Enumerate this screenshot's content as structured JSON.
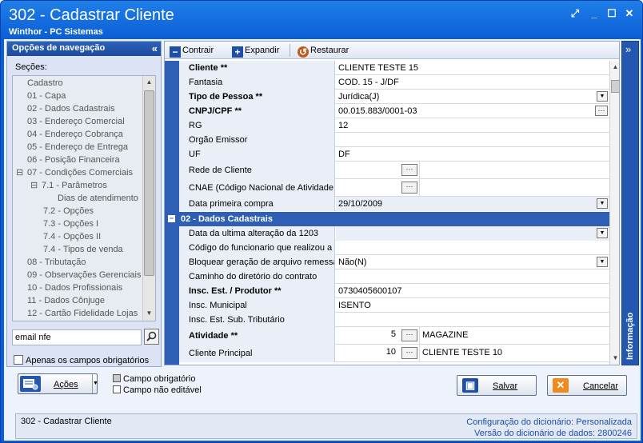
{
  "window": {
    "title": "302 - Cadastrar Cliente",
    "subtitle": "Winthor - PC Sistemas",
    "buttons": [
      "⤢",
      "_",
      "☐",
      "✕"
    ]
  },
  "nav": {
    "header": "Opções de navegação",
    "sections_label": "Seções:",
    "items": [
      "Cadastro",
      "01 - Capa",
      "02 - Dados Cadastrais",
      "03 - Endereço Comercial",
      "04 - Endereço Cobrança",
      "05 - Endereço de Entrega",
      "06 - Posição Financeira",
      "07 - Condições Comerciais",
      "7.1 - Parâmetros",
      "Dias de atendimento",
      "7.2 - Opções",
      "7.3 - Opções I",
      "7.4 - Opções II",
      "7.4 - Tipos de venda",
      "08 - Tributação",
      "09 - Observações Gerenciais",
      "10 - Dados Profissionais",
      "11 - Dados Cônjuge",
      "12 - Cartão Fidelidade Lojas"
    ],
    "search_value": "email nfe",
    "only_required_label": "Apenas os campos obrigatórios"
  },
  "toolbar": {
    "collapse": "Contrair",
    "expand": "Expandir",
    "restore": "Restaurar"
  },
  "grid": {
    "rows1": [
      {
        "label": "Cliente **",
        "bold": true,
        "value": "CLIENTE TESTE 15"
      },
      {
        "label": "Fantasia",
        "value": "COD. 15 - J/DF"
      },
      {
        "label": "Tipo de Pessoa **",
        "bold": true,
        "value": "Jurídica(J)"
      },
      {
        "label": "CNPJ/CPF **",
        "bold": true,
        "value": "00.015.883/0001-03"
      },
      {
        "label": "RG",
        "value": "12"
      },
      {
        "label": "Orgão Emissor",
        "value": ""
      },
      {
        "label": "UF",
        "value": "DF"
      },
      {
        "label": "Rede de Cliente",
        "value": ""
      },
      {
        "label": "CNAE (Código Nacional de Atividade E",
        "value": ""
      },
      {
        "label": "Data primeira compra",
        "value": "29/10/2009"
      }
    ],
    "section2": "02 - Dados Cadastrais",
    "rows2": [
      {
        "label": "Data da ultima alteração da 1203",
        "value": ""
      },
      {
        "label": "Código do funcionario que realizou a u",
        "value": ""
      },
      {
        "label": "Bloquear geração de arquivo remessa",
        "value": "Não(N)"
      },
      {
        "label": "Caminho do diretório do contrato",
        "value": ""
      },
      {
        "label": "Insc. Est. / Produtor **",
        "bold": true,
        "value": "0730405600107"
      },
      {
        "label": "Insc. Municipal",
        "value": "ISENTO"
      },
      {
        "label": "Insc. Est. Sub. Tributário",
        "value": ""
      },
      {
        "label": "Atividade **",
        "bold": true,
        "code": "5",
        "value": "MAGAZINE"
      },
      {
        "label": "Cliente Principal",
        "code": "10",
        "value": "CLIENTE TESTE 10"
      }
    ]
  },
  "info_panel": "Informação",
  "bottom": {
    "actions": "Ações",
    "legend_required": "Campo obrigatório",
    "legend_not_editable": "Campo não editável",
    "save": "Salvar",
    "cancel": "Cancelar"
  },
  "status": {
    "left": "302 - Cadastrar Cliente",
    "config_label": "Configuração do dicionário:",
    "config_value": "Personalizada",
    "version_label": "Versão do dicionário de dados:",
    "version_value": "2800246"
  },
  "colors": {
    "title_bar": "#0b5ed6",
    "grid_bar": "#2f5fb5",
    "label_bg": "#e9eef7"
  }
}
